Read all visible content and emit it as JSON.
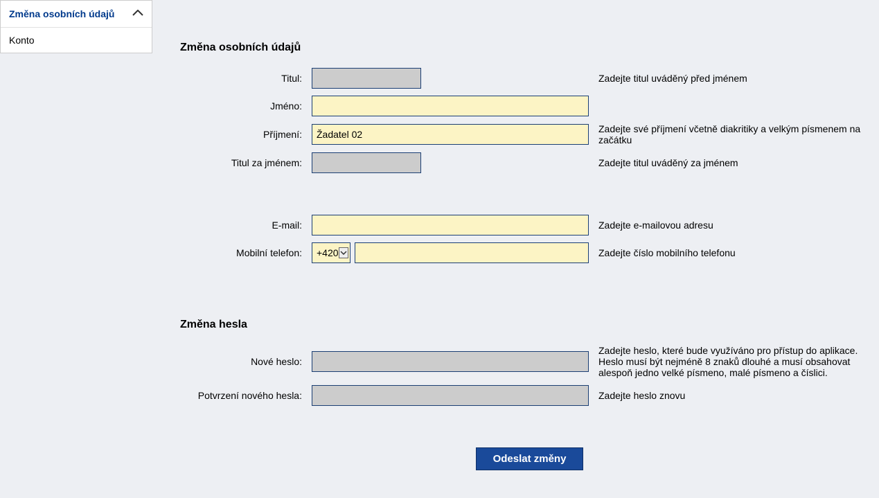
{
  "sidebar": {
    "items": [
      {
        "label": "Změna osobních údajů",
        "active": true,
        "expandable": true
      },
      {
        "label": "Konto",
        "active": false,
        "expandable": false
      }
    ]
  },
  "form": {
    "section1_title": "Změna osobních údajů",
    "section2_title": "Změna hesla",
    "fields": {
      "titul": {
        "label": "Titul:",
        "value": "",
        "hint": "Zadejte titul uváděný před jménem"
      },
      "jmeno": {
        "label": "Jméno:",
        "value": "",
        "hint": ""
      },
      "prijmeni": {
        "label": "Příjmení:",
        "value": "Žadatel 02",
        "hint": "Zadejte své příjmení včetně diakritiky a velkým písmenem na začátku"
      },
      "titul_za": {
        "label": "Titul za jménem:",
        "value": "",
        "hint": "Zadejte titul uváděný za jménem"
      },
      "email": {
        "label": "E-mail:",
        "value": "",
        "hint": "Zadejte e-mailovou adresu"
      },
      "telefon": {
        "label": "Mobilní telefon:",
        "prefix": "+420",
        "value": "",
        "hint": "Zadejte číslo mobilního telefonu"
      },
      "nove_heslo": {
        "label": "Nové heslo:",
        "value": "",
        "hint": "Zadejte heslo, které bude využíváno pro přístup do aplikace. Heslo musí být nejméně 8 znaků dlouhé a musí obsahovat alespoň jedno velké písmeno, malé písmeno a číslici."
      },
      "potvrzeni_hesla": {
        "label": "Potvrzení nového hesla:",
        "value": "",
        "hint": "Zadejte heslo znovu"
      }
    },
    "submit_label": "Odeslat změny"
  }
}
